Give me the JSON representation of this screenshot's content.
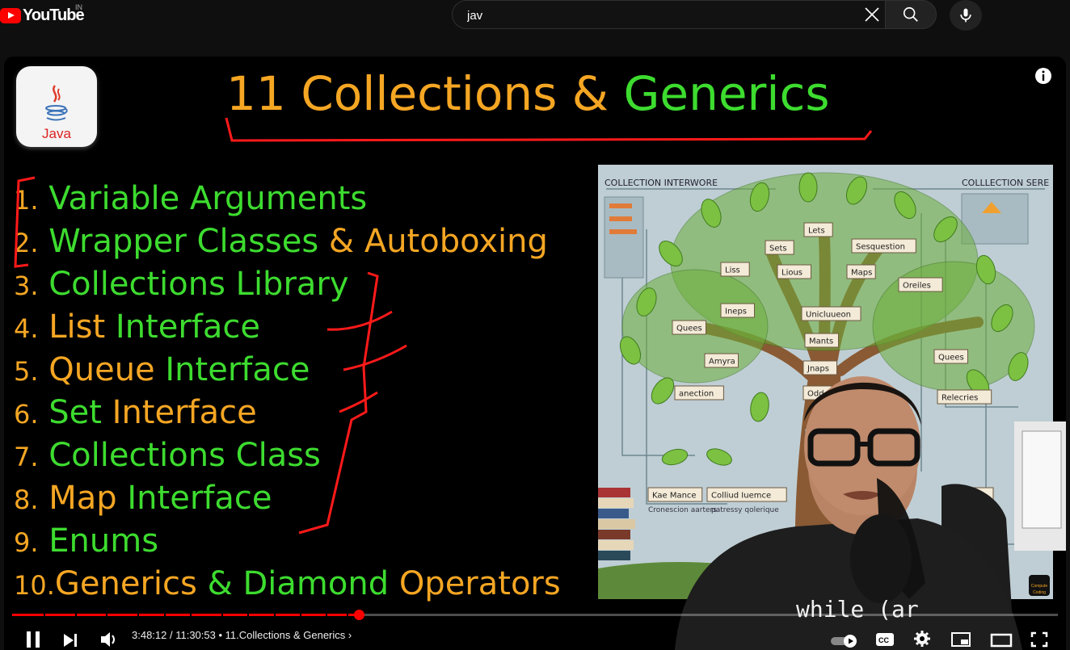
{
  "header": {
    "logo_text": "YouTube",
    "country_code": "IN",
    "search_value": "jav",
    "search_placeholder": "Search"
  },
  "video": {
    "title_part1": "11 Collections &",
    "title_part2": "Generics",
    "java_logo_label": "Java",
    "topics": [
      {
        "num": "1.",
        "parts": [
          {
            "t": "Variable Arguments",
            "c": "green"
          }
        ]
      },
      {
        "num": "2.",
        "parts": [
          {
            "t": "Wrapper Classes",
            "c": "green"
          },
          {
            "t": " & Autoboxing",
            "c": "orange"
          }
        ]
      },
      {
        "num": "3.",
        "parts": [
          {
            "t": "Collections Library",
            "c": "green"
          }
        ]
      },
      {
        "num": "4.",
        "parts": [
          {
            "t": "List ",
            "c": "orange"
          },
          {
            "t": "Interface",
            "c": "green"
          }
        ]
      },
      {
        "num": "5.",
        "parts": [
          {
            "t": "Queue ",
            "c": "orange"
          },
          {
            "t": "Interface",
            "c": "green"
          }
        ]
      },
      {
        "num": "6.",
        "parts": [
          {
            "t": "Set ",
            "c": "green"
          },
          {
            "t": "Interface",
            "c": "orange"
          }
        ]
      },
      {
        "num": "7.",
        "parts": [
          {
            "t": "Collections Class",
            "c": "green"
          }
        ]
      },
      {
        "num": "8.",
        "parts": [
          {
            "t": "Map ",
            "c": "orange"
          },
          {
            "t": "Interface",
            "c": "green"
          }
        ]
      },
      {
        "num": "9.",
        "parts": [
          {
            "t": "Enums",
            "c": "green"
          }
        ]
      },
      {
        "num": "10.",
        "parts": [
          {
            "t": "Generics",
            "c": "orange"
          },
          {
            "t": " & Diamond ",
            "c": "green"
          },
          {
            "t": "Operators",
            "c": "orange"
          }
        ]
      }
    ],
    "tree_labels": {
      "header_left": "COLLECTION INTERWORE",
      "header_right": "COLLLECTION SERE",
      "nodes": [
        "Lets",
        "Sets",
        "Sesquestion",
        "Liss",
        "Lious",
        "Maps",
        "Oreiles",
        "Ineps",
        "Unicluueon",
        "Quees",
        "Mants",
        "Quees",
        "Amyra",
        "Jnaps",
        "anection",
        "Odde",
        "Relecries",
        "Culect",
        "Kae Mance",
        "Colliud Iuemce",
        "ps"
      ],
      "footer_left": "Cronescion aarters",
      "footer_mid": "patressy qolerique",
      "badge": "Compute Coding"
    },
    "shirt_text": "while (ar"
  },
  "player": {
    "current_time": "3:48:12",
    "duration": "11:30:53",
    "time_display": "3:48:12 / 11:30:53",
    "chapter": "11.Collections & Generics",
    "progress": 0.3318,
    "chapter_marks": [
      0.03,
      0.06,
      0.09,
      0.12,
      0.145,
      0.17,
      0.2,
      0.225,
      0.25,
      0.275,
      0.3,
      0.32
    ]
  },
  "colors": {
    "orange": "#f5a623",
    "green": "#3ddc2f",
    "progress": "#ff0000",
    "annotation": "#ff1a1a"
  }
}
